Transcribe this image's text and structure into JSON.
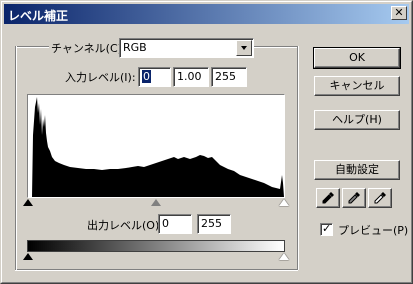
{
  "window": {
    "title": "レベル補正",
    "close_glyph": "✕"
  },
  "channel": {
    "label": "チャンネル(C):",
    "value": "RGB"
  },
  "input_levels": {
    "label": "入力レベル(I):",
    "black": "0",
    "gamma": "1.00",
    "white": "255"
  },
  "output_levels": {
    "label": "出力レベル(O):",
    "black": "0",
    "white": "255"
  },
  "buttons": {
    "ok": "OK",
    "cancel": "キャンセル",
    "help": "ヘルプ(H)",
    "auto": "自動設定"
  },
  "preview": {
    "label": "プレビュー(P)",
    "checked": true,
    "check_glyph": "✓"
  },
  "eyedroppers": [
    "black-eyedropper-icon",
    "gray-eyedropper-icon",
    "white-eyedropper-icon"
  ],
  "colors": {
    "title_start": "#0a246a",
    "title_end": "#a6caf0",
    "face": "#d4d0c8"
  }
}
